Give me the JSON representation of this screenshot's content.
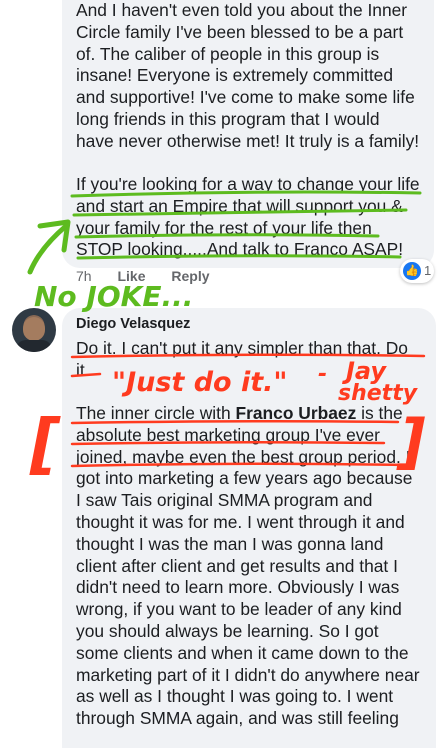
{
  "comment1": {
    "text_top": "And I haven't even told you about the Inner\nCircle family I've been blessed to be a part\nof. The caliber of people in this group is\ninsane! Everyone is extremely committed\nand supportive! I've come to make some life\nlong friends in this program that I would\nhave never otherwise met! It truly is a family!",
    "text_bottom": "If you're looking for a way to change your life\nand start an Empire that will support you &\nyour family for the rest of your life then\nSTOP looking.....And talk to Franco ASAP!",
    "time": "7h",
    "like_label": "Like",
    "reply_label": "Reply",
    "reaction_count": "1",
    "reaction_icon": "thumbs-up-icon"
  },
  "comment2": {
    "author": "Diego Velasquez",
    "text_intro": "Do it. I can't put it any simpler than that. Do\nit.",
    "text_body_before": "The inner circle with ",
    "text_body_name": "Franco Urbaez",
    "text_body_after": " is the\nabsolute best marketing group I've ever\njoined, maybe even the best group period. I\ngot into marketing a few years ago because\nI saw Tais original SMMA program and\nthought it was for me. I went through it and\nthought I was the man I was gonna land\nclient after client and get results and that I\ndidn't need to learn more. Obviously I was\nwrong, if you want to be leader of any kind\nyou should always be learning. So I got\nsome clients and when it came down to the\nmarketing part of it I didn't do anywhere near\nas well as I thought I was going to. I went\nthrough SMMA again, and was still feeling"
  },
  "annotations": {
    "no_joke": "No JOKE...",
    "just_do_it": "\"Just do it.\"",
    "dash": "-",
    "jay": "Jay",
    "shetty": "shetty",
    "bracket_left": "[",
    "bracket_right": "]",
    "green": "#5dbb1f",
    "red": "#ff3b1f"
  }
}
